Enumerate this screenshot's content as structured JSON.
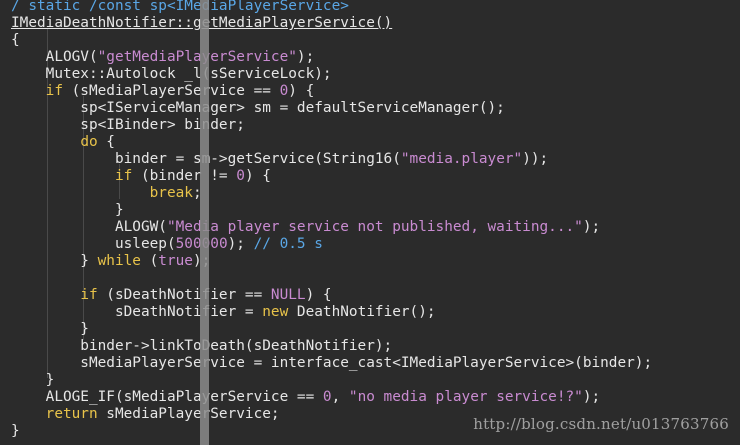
{
  "lines": [
    {
      "segments": [
        {
          "t": "/ static /const sp<IMediaPlayerService>",
          "c": "comment"
        }
      ]
    },
    {
      "segments": [
        {
          "t": "IMediaDeathNotifier::getMediaPlayerService()",
          "c": "default",
          "u": true
        }
      ]
    },
    {
      "segments": [
        {
          "t": "{",
          "c": "default"
        }
      ]
    },
    {
      "segments": [
        {
          "t": "    ALOGV(",
          "c": "default"
        },
        {
          "t": "\"getMediaPlayerService\"",
          "c": "str"
        },
        {
          "t": ");",
          "c": "default"
        }
      ]
    },
    {
      "segments": [
        {
          "t": "    Mutex::Autolock _l(sServiceLock);",
          "c": "default"
        }
      ]
    },
    {
      "segments": [
        {
          "t": "    ",
          "c": "default"
        },
        {
          "t": "if",
          "c": "kw"
        },
        {
          "t": " (sMediaPlayerService == ",
          "c": "default"
        },
        {
          "t": "0",
          "c": "num"
        },
        {
          "t": ") {",
          "c": "default"
        }
      ]
    },
    {
      "segments": [
        {
          "t": "        sp<IServiceManager> sm = defaultServiceManager();",
          "c": "default"
        }
      ]
    },
    {
      "segments": [
        {
          "t": "        sp<IBinder> binder;",
          "c": "default"
        }
      ]
    },
    {
      "segments": [
        {
          "t": "        ",
          "c": "default"
        },
        {
          "t": "do",
          "c": "kw"
        },
        {
          "t": " {",
          "c": "default"
        }
      ]
    },
    {
      "segments": [
        {
          "t": "            binder = sm->getService(String16(",
          "c": "default"
        },
        {
          "t": "\"media.player\"",
          "c": "str"
        },
        {
          "t": "));",
          "c": "default"
        }
      ]
    },
    {
      "segments": [
        {
          "t": "            ",
          "c": "default"
        },
        {
          "t": "if",
          "c": "kw"
        },
        {
          "t": " (binder != ",
          "c": "default"
        },
        {
          "t": "0",
          "c": "num"
        },
        {
          "t": ") {",
          "c": "default"
        }
      ]
    },
    {
      "segments": [
        {
          "t": "                ",
          "c": "default"
        },
        {
          "t": "break",
          "c": "kw"
        },
        {
          "t": ";",
          "c": "default"
        }
      ]
    },
    {
      "segments": [
        {
          "t": "            }",
          "c": "default"
        }
      ]
    },
    {
      "segments": [
        {
          "t": "            ALOGW(",
          "c": "default"
        },
        {
          "t": "\"Media player service not published, waiting...\"",
          "c": "str"
        },
        {
          "t": ");",
          "c": "default"
        }
      ]
    },
    {
      "segments": [
        {
          "t": "            usleep(",
          "c": "default"
        },
        {
          "t": "500000",
          "c": "num"
        },
        {
          "t": "); ",
          "c": "default"
        },
        {
          "t": "// 0.5 s",
          "c": "comment"
        }
      ]
    },
    {
      "segments": [
        {
          "t": "        } ",
          "c": "default"
        },
        {
          "t": "while",
          "c": "kw"
        },
        {
          "t": " (",
          "c": "default"
        },
        {
          "t": "true",
          "c": "num"
        },
        {
          "t": ");",
          "c": "default"
        }
      ]
    },
    {
      "segments": [
        {
          "t": "",
          "c": "default"
        }
      ]
    },
    {
      "segments": [
        {
          "t": "        ",
          "c": "default"
        },
        {
          "t": "if",
          "c": "kw"
        },
        {
          "t": " (sDeathNotifier == ",
          "c": "default"
        },
        {
          "t": "NULL",
          "c": "num"
        },
        {
          "t": ") {",
          "c": "default"
        }
      ]
    },
    {
      "segments": [
        {
          "t": "            sDeathNotifier = ",
          "c": "default"
        },
        {
          "t": "new",
          "c": "kw"
        },
        {
          "t": " DeathNotifier();",
          "c": "default"
        }
      ]
    },
    {
      "segments": [
        {
          "t": "        }",
          "c": "default"
        }
      ]
    },
    {
      "segments": [
        {
          "t": "        binder->linkToDeath(sDeathNotifier);",
          "c": "default"
        }
      ]
    },
    {
      "segments": [
        {
          "t": "        sMediaPlayerService = interface_cast<IMediaPlayerService>(binder);",
          "c": "default"
        }
      ]
    },
    {
      "segments": [
        {
          "t": "    }",
          "c": "default"
        }
      ]
    },
    {
      "segments": [
        {
          "t": "    ALOGE_IF(sMediaPlayerService == ",
          "c": "default"
        },
        {
          "t": "0",
          "c": "num"
        },
        {
          "t": ", ",
          "c": "default"
        },
        {
          "t": "\"no media player service!?\"",
          "c": "str"
        },
        {
          "t": ");",
          "c": "default"
        }
      ]
    },
    {
      "segments": [
        {
          "t": "    ",
          "c": "default"
        },
        {
          "t": "return",
          "c": "kw"
        },
        {
          "t": " sMediaPlayerService;",
          "c": "default"
        }
      ]
    },
    {
      "segments": [
        {
          "t": "}",
          "c": "default"
        }
      ]
    }
  ],
  "watermark": "http://blog.csdn.net/u013763766"
}
